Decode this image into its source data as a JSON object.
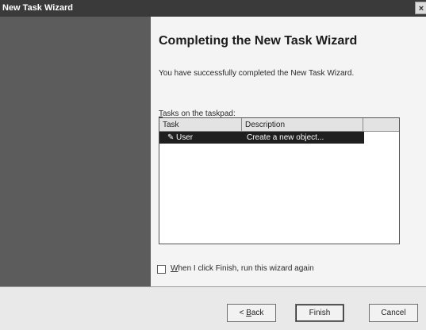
{
  "window": {
    "title": "New Task Wizard",
    "close_glyph": "×"
  },
  "content": {
    "heading": "Completing the New Task Wizard",
    "description": "You have successfully completed the New Task Wizard.",
    "list_label_accel": "T",
    "list_label_rest": "asks on the taskpad:"
  },
  "listview": {
    "columns": [
      "Task",
      "Description",
      ""
    ],
    "rows": [
      {
        "task": "User",
        "description": "Create a new object...",
        "icon": "pin-icon"
      }
    ]
  },
  "checkbox": {
    "checked": false,
    "label_accel": "W",
    "label_rest": "hen I click Finish, run this wizard again"
  },
  "buttons": {
    "back_prefix": "< ",
    "back_accel": "B",
    "back_rest": "ack",
    "finish": "Finish",
    "cancel": "Cancel"
  }
}
